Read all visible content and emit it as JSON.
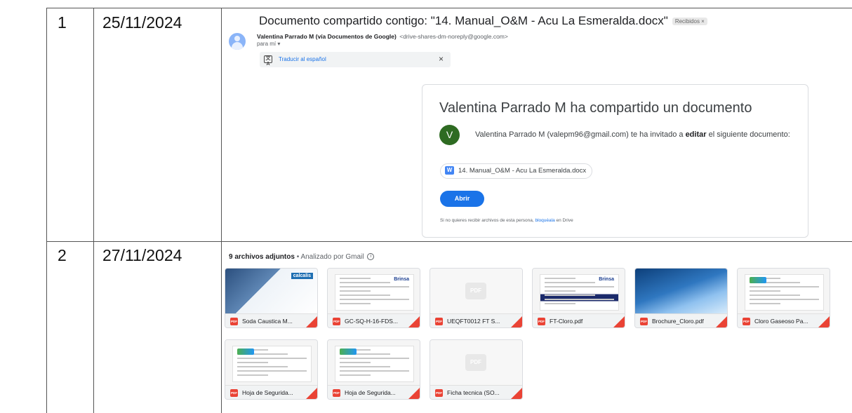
{
  "rows": [
    {
      "num": "1",
      "date": "25/11/2024"
    },
    {
      "num": "2",
      "date": "27/11/2024"
    }
  ],
  "email1": {
    "subject": "Documento compartido contigo: \"14. Manual_O&M - Acu La Esmeralda.docx\"",
    "badge": "Recibidos ×",
    "sender_name": "Valentina Parrado M (vía Documentos de Google)",
    "sender_email": "<drive-shares-dm-noreply@google.com>",
    "to": "para mí ▾",
    "translate_label": "Traducir al español",
    "translate_close": "×",
    "translate_icon_glyph": "文A",
    "card": {
      "title": "Valentina Parrado M ha compartido un documento",
      "avatar_letter": "V",
      "invite_pre": "Valentina Parrado M (valepm96@gmail.com) te ha invitado a ",
      "invite_bold": "editar",
      "invite_post": " el siguiente documento:",
      "doc_icon": "W",
      "doc_name": "14. Manual_O&M - Acu La Esmeralda.docx",
      "open_label": "Abrir",
      "footer_pre": "Si no quieres recibir archivos de esta persona, ",
      "footer_link": "bloquéala",
      "footer_post": " en Drive"
    }
  },
  "email2": {
    "attach_count": "9 archivos adjuntos",
    "attach_sep": " • ",
    "scan_label": "Analizado por Gmail",
    "info_glyph": "i",
    "pdf_badge": "PDF",
    "thumb_texts": {
      "calcalis": "calcalis",
      "brinsa": "Brinsa"
    },
    "attachments": [
      {
        "name": "Soda Caustica M...",
        "thumb": "photo-blue"
      },
      {
        "name": "GC-SQ-H-16-FDS...",
        "thumb": "doc-brinsa"
      },
      {
        "name": "UEQFT0012 FT S...",
        "thumb": "pdf-placeholder"
      },
      {
        "name": "FT-Cloro.pdf",
        "thumb": "doc-table"
      },
      {
        "name": "Brochure_Cloro.pdf",
        "thumb": "photo-water"
      },
      {
        "name": "Cloro Gaseoso Pa...",
        "thumb": "doc-green"
      },
      {
        "name": "Hoja de Segurida...",
        "thumb": "doc-green"
      },
      {
        "name": "Hoja de Segurida...",
        "thumb": "doc-green"
      },
      {
        "name": "Ficha tecnica (SO...",
        "thumb": "pdf-placeholder"
      }
    ]
  }
}
